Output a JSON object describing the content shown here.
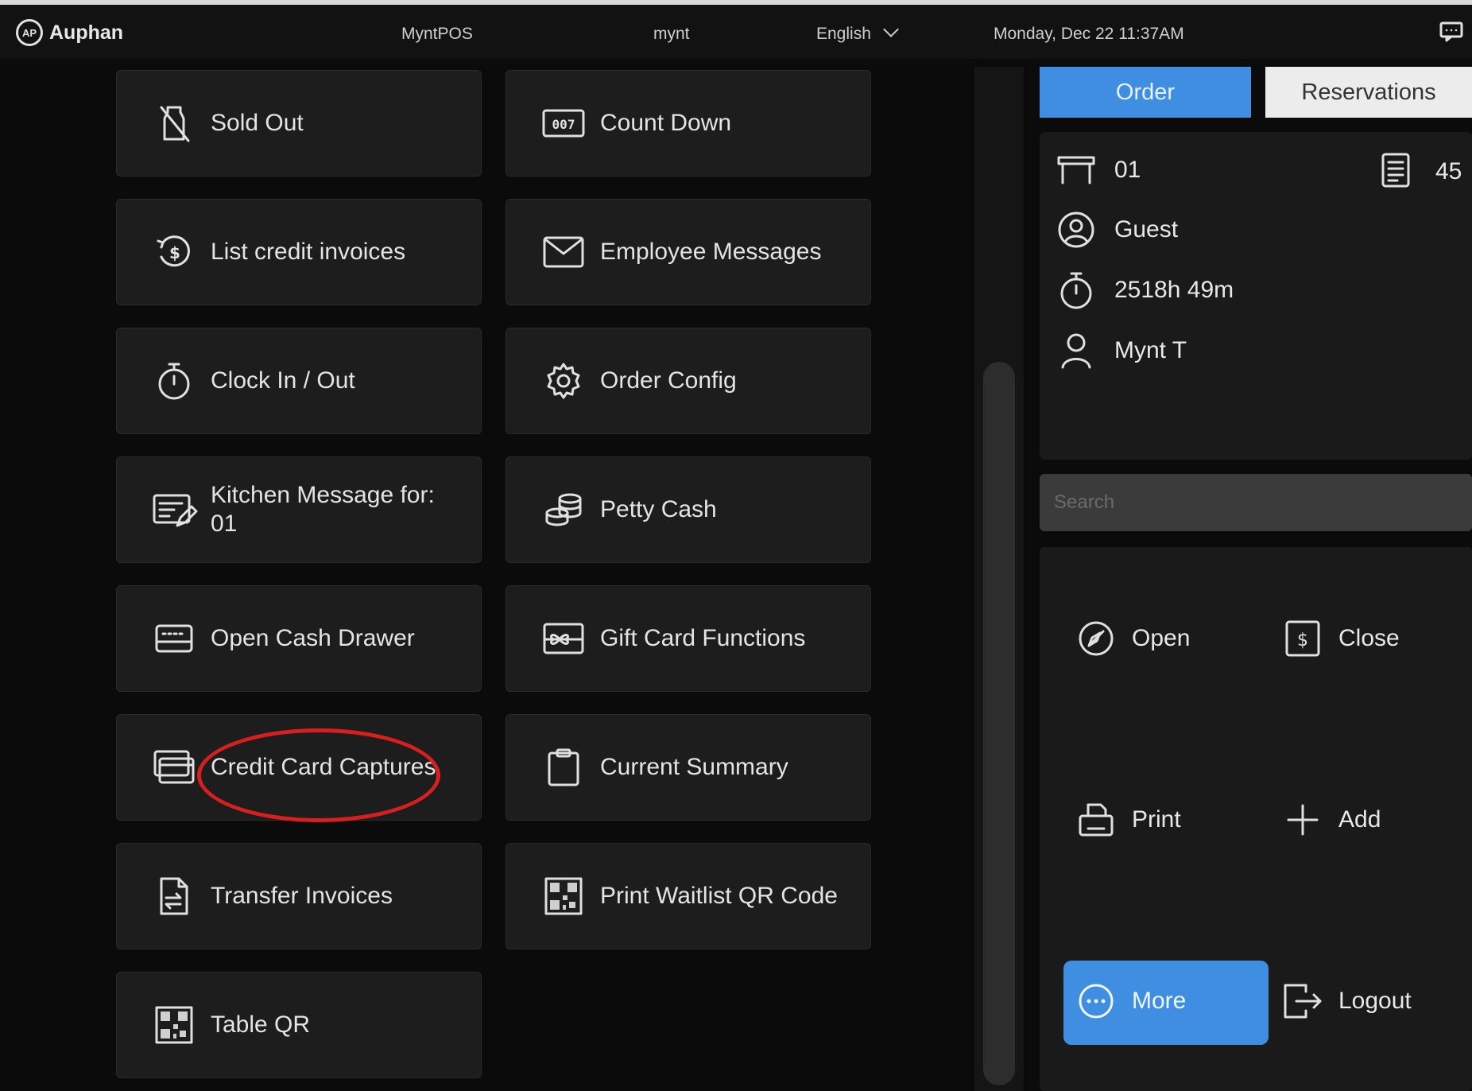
{
  "topbar": {
    "brand": "Auphan",
    "brand_mark": "AP",
    "app_name": "MyntPOS",
    "user": "mynt",
    "language": "English",
    "datetime": "Monday, Dec 22 11:37AM"
  },
  "tiles": [
    {
      "label": "Sold Out",
      "icon": "sold-out-icon"
    },
    {
      "label": "Count Down",
      "icon": "countdown-icon"
    },
    {
      "label": "List credit invoices",
      "icon": "credit-invoice-icon"
    },
    {
      "label": "Employee Messages",
      "icon": "mail-icon"
    },
    {
      "label": "Clock In / Out",
      "icon": "stopwatch-icon"
    },
    {
      "label": "Order Config",
      "icon": "gear-icon"
    },
    {
      "label": "Kitchen Message for:\n01",
      "icon": "kitchen-message-icon"
    },
    {
      "label": "Petty Cash",
      "icon": "coins-icon"
    },
    {
      "label": "Open Cash Drawer",
      "icon": "cash-drawer-icon"
    },
    {
      "label": "Gift Card Functions",
      "icon": "gift-card-icon"
    },
    {
      "label": "Credit Card Captures",
      "icon": "credit-card-icon"
    },
    {
      "label": "Current Summary",
      "icon": "clipboard-icon"
    },
    {
      "label": "Transfer Invoices",
      "icon": "transfer-document-icon"
    },
    {
      "label": "Print Waitlist QR Code",
      "icon": "qr-code-icon"
    },
    {
      "label": "Table QR",
      "icon": "qr-code-icon"
    }
  ],
  "tabs": {
    "order": "Order",
    "reservations": "Reservations"
  },
  "order_info": {
    "table": "01",
    "items_count": "45",
    "guest": "Guest",
    "elapsed": "2518h 49m",
    "server": "Mynt T"
  },
  "search": {
    "placeholder": "Search",
    "value": ""
  },
  "actions": {
    "open": "Open",
    "close": "Close",
    "print": "Print",
    "add": "Add",
    "more": "More",
    "logout": "Logout"
  },
  "colors": {
    "accent": "#3f8ee2",
    "highlight_circle": "#d81f1f",
    "tile_bg": "#1d1d1d"
  }
}
